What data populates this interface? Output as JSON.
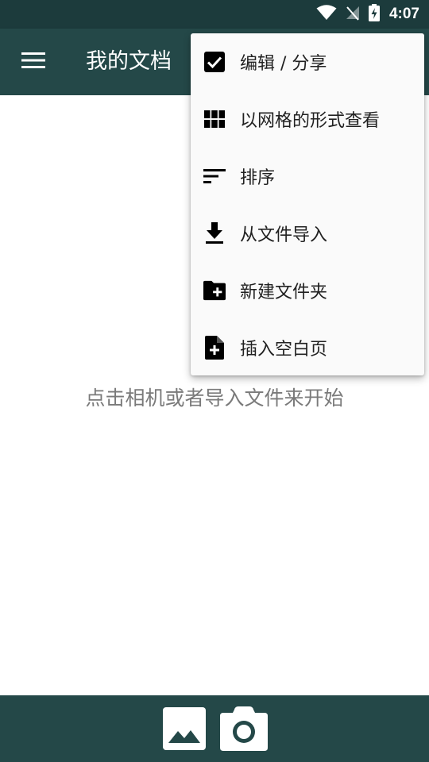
{
  "status_bar": {
    "time": "4:07",
    "icons": [
      "wifi-icon",
      "no-signal-icon",
      "battery-charging-icon"
    ]
  },
  "app_bar": {
    "menu_icon": "hamburger-menu-icon",
    "title": "我的文档"
  },
  "overflow_menu": {
    "items": [
      {
        "label": "编辑 / 分享",
        "icon": "checkbox-checked-icon"
      },
      {
        "label": "以网格的形式查看",
        "icon": "grid-view-icon"
      },
      {
        "label": "排序",
        "icon": "sort-icon"
      },
      {
        "label": "从文件导入",
        "icon": "download-icon"
      },
      {
        "label": "新建文件夹",
        "icon": "new-folder-icon"
      },
      {
        "label": "插入空白页",
        "icon": "new-page-icon"
      }
    ]
  },
  "main": {
    "empty_hint": "点击相机或者导入文件来开始"
  },
  "bottom_bar": {
    "gallery_icon": "gallery-image-icon",
    "camera_icon": "camera-icon"
  },
  "colors": {
    "status_bar": "#1c3b3c",
    "app_bar": "#244848",
    "menu_background": "#fafafa",
    "hint_text": "#7a7a7a"
  }
}
